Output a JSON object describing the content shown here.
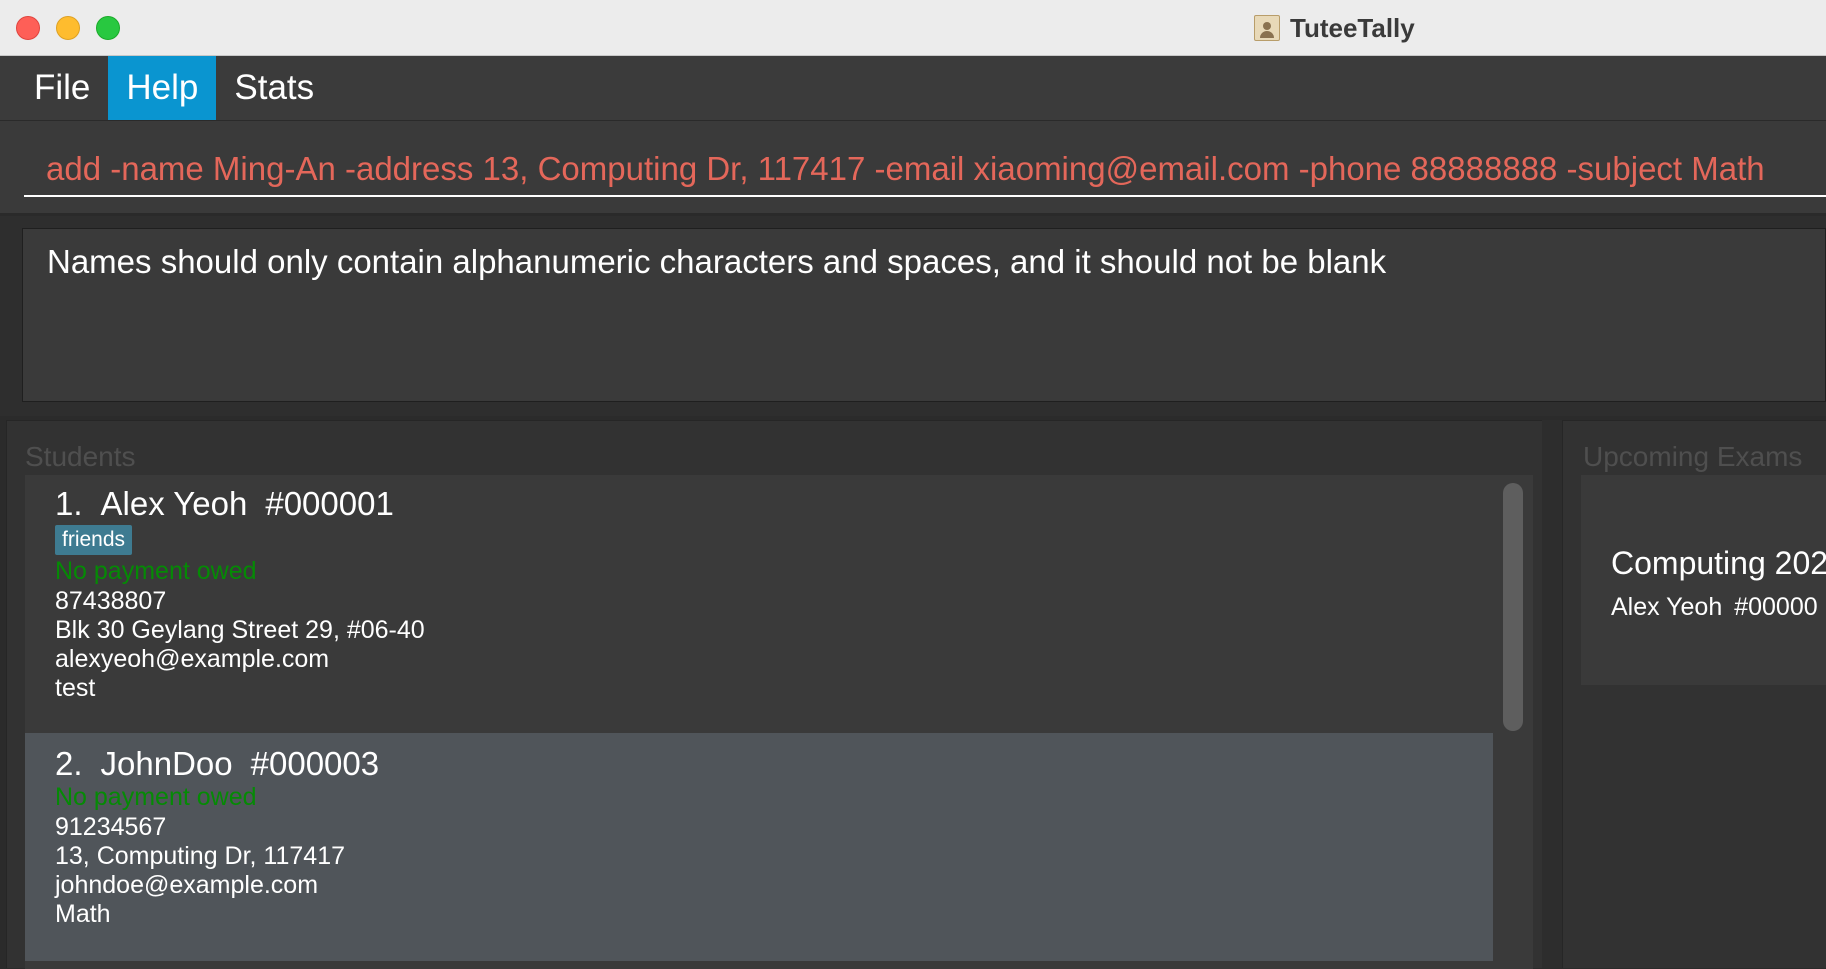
{
  "window": {
    "title": "TuteeTally",
    "app_icon": "contacts-icon"
  },
  "menu": {
    "items": [
      {
        "label": "File",
        "active": false
      },
      {
        "label": "Help",
        "active": true
      },
      {
        "label": "Stats",
        "active": false
      }
    ]
  },
  "command": {
    "value": "add -name Ming-An -address 13, Computing Dr, 117417 -email xiaoming@email.com -phone 88888888 -subject Math",
    "text_color": "#e4675a"
  },
  "result": {
    "message": "Names should only contain alphanumeric characters and spaces, and it should not be blank"
  },
  "students": {
    "label": "Students",
    "items": [
      {
        "index": "1.",
        "name": "Alex Yeoh",
        "id": "#000001",
        "tags": [
          "friends"
        ],
        "payment": "No payment owed",
        "phone": "87438807",
        "address": "Blk 30 Geylang Street 29, #06-40",
        "email": "alexyeoh@example.com",
        "subject": "test"
      },
      {
        "index": "2.",
        "name": "JohnDoo",
        "id": "#000003",
        "tags": [],
        "payment": "No payment owed",
        "phone": "91234567",
        "address": "13, Computing Dr, 117417",
        "email": "johndoe@example.com",
        "subject": "Math"
      }
    ]
  },
  "exams": {
    "label": "Upcoming Exams",
    "items": [
      {
        "title": "Computing 202",
        "student_name": "Alex Yeoh",
        "student_id": "#00000"
      }
    ]
  },
  "colors": {
    "accent": "#0a95d0",
    "payment_ok": "#058a05",
    "tag_bg": "#3e7b91"
  }
}
